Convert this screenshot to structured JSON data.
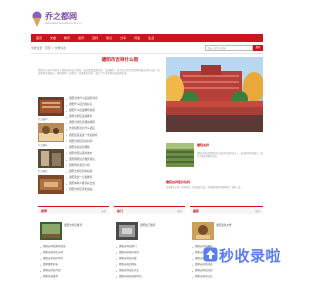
{
  "header": {
    "logo_text": "乔之都网",
    "logo_subtitle": "www.www.qiaozhidu.com.cn"
  },
  "nav": [
    "首页",
    "文章",
    "教育",
    "资讯",
    "百科",
    "知识",
    "分享",
    "问答",
    "生活"
  ],
  "breadcrumb": "当前位置：首页 > 文章列表",
  "search": {
    "placeholder": "请输入搜索关键词",
    "button_label": "搜索"
  },
  "featured": {
    "title": "德阳市吉祥什么街",
    "text": "德阳市吉祥什么街位于德阳市区核心地段，周边配套设施完善，交通便利，是市民日常生活和休闲娱乐的好去处。街道两旁商铺林立，餐饮购物一应俱全，环境整洁优美，吸引了众多游客前来参观游览。"
  },
  "left_thumbs": [
    "乔之都网...",
    "乔之都网...",
    "乔之都网..."
  ],
  "mid_list": [
    "德阳吉祥什么街最新消息",
    "德阳什么街比较好玩",
    "德阳什么街最繁华热闹",
    "德阳吉祥街美食推荐",
    "德阳吉祥街位置在哪里",
    "吉祥街附近有什么酒店",
    "德阳街道美食一条街推荐",
    "德阳吉祥街营业时间",
    "德阳商业街有哪些",
    "德阳市区好逛的地方",
    "德阳哪里适合散步游玩",
    "德阳特色老街介绍",
    "德阳吉祥街停车指南",
    "德阳周边一日游推荐",
    "德阳本地人推荐好去处",
    "德阳吉祥街历史由来"
  ],
  "right": {
    "tag1": "德阳吉祥",
    "text1": "德阳吉祥街是德阳市区比较有名的街道之一，街道两旁商铺林立，吸引了很多游客和市民。",
    "tag2": "德阳吉祥街好玩吗",
    "text2": "街道整洁干净，环境优美，周边配套完善，是休闲购物的理想场所，值得一去。"
  },
  "sections": [
    {
      "title": "推荐",
      "more": "更多",
      "thumb_caption": "德阳吉祥街推荐",
      "items": [
        "德阳吉祥街推荐阅读",
        "德阳吉祥街怎么样",
        "德阳吉祥街好不好",
        "德阳哪里好玩",
        "德阳吉祥街介绍",
        "德阳街道推荐"
      ]
    },
    {
      "title": "热门",
      "more": "更多",
      "thumb_caption": "德阳热门推荐",
      "items": [
        "德阳吉祥街热门",
        "德阳吉祥街好吃的",
        "德阳吉祥街在哪",
        "德阳吉祥街地址",
        "德阳吉祥街怎么走",
        "德阳吉祥街开放时间"
      ]
    },
    {
      "title": "最新",
      "more": "更多",
      "thumb_caption": "德阳最新文章",
      "items": [
        "德阳吉祥街最新",
        "德阳吉祥街资讯",
        "德阳吉祥街新闻",
        "德阳吉祥街动态",
        "德阳吉祥街活动",
        "德阳吉祥街公告"
      ]
    }
  ],
  "watermark": "秒收录啦",
  "colors": {
    "brand_red": "#c9151e",
    "logo_purple": "#7d4ea6",
    "watermark_blue": "#5a7ef0"
  }
}
